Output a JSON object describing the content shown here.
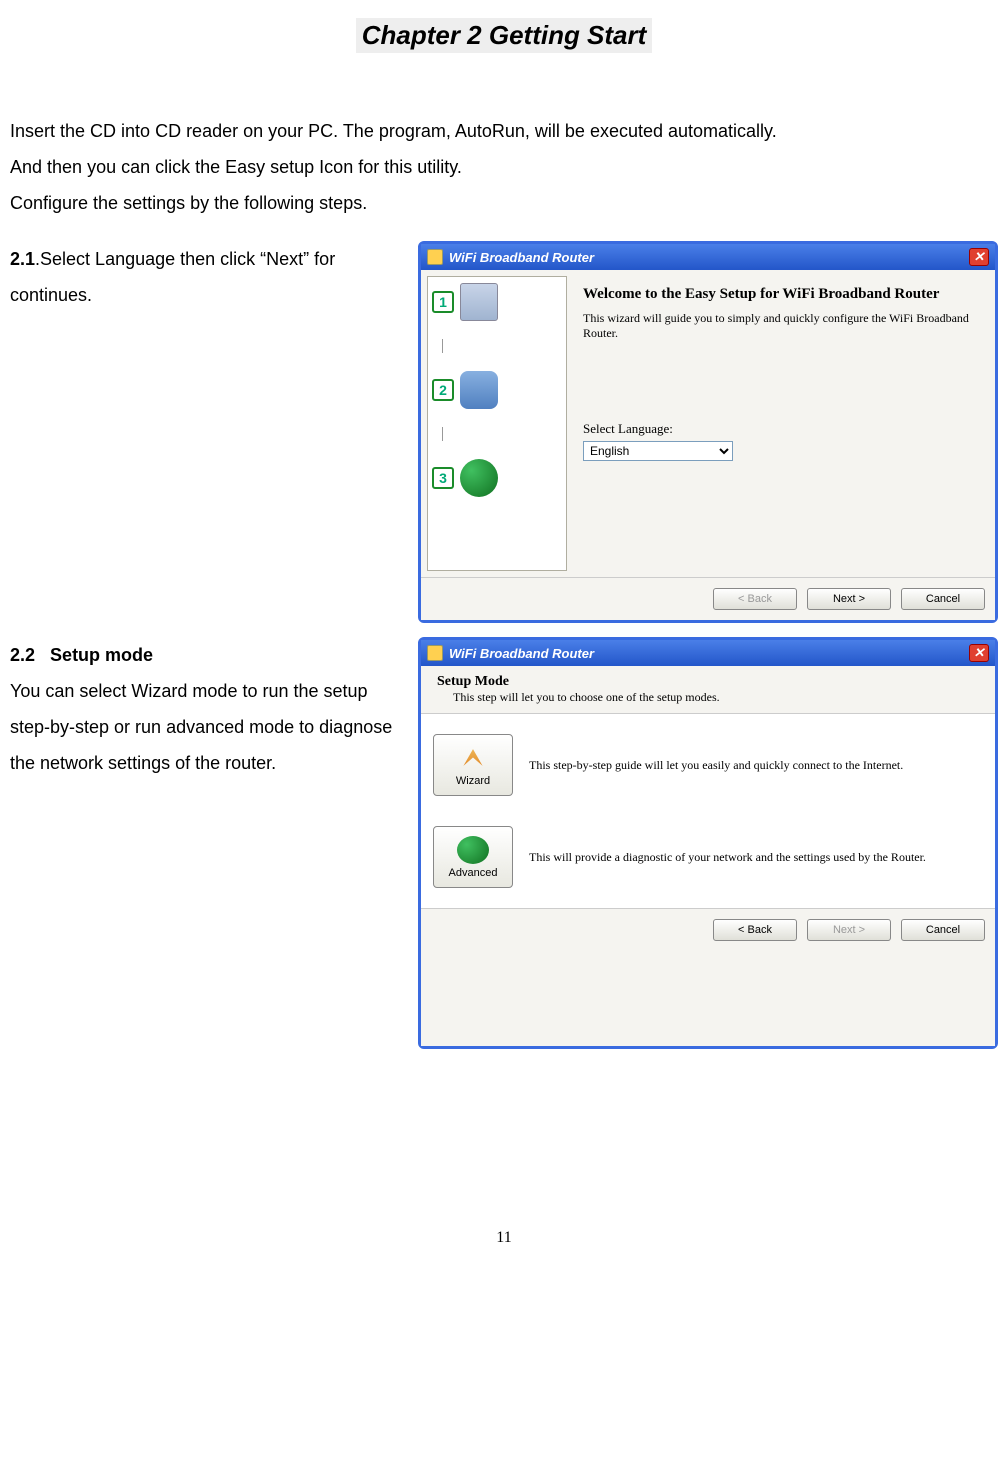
{
  "chapter_title": "Chapter 2    Getting Start",
  "intro_lines": [
    "Insert the CD into CD reader on your PC. The program, AutoRun, will be executed automatically.",
    "And then you can click the Easy setup Icon for this utility.",
    "Configure the settings by the following steps."
  ],
  "section21": {
    "num": "2.1",
    "text": ".Select Language then click “Next” for continues."
  },
  "section22": {
    "num": "2.2",
    "heading": "Setup mode",
    "text": "You can select Wizard mode to run the setup step-by-step or run advanced mode to diagnose the network settings of the router."
  },
  "dialog1": {
    "title": "WiFi Broadband Router",
    "welcome_title": "Welcome to the Easy Setup for WiFi Broadband Router",
    "welcome_sub": "This wizard will guide you to simply and quickly configure the WiFi Broadband Router.",
    "lang_label": "Select Language:",
    "lang_value": "English",
    "steps": [
      "1",
      "2",
      "3"
    ],
    "btn_back": "< Back",
    "btn_next": "Next >",
    "btn_cancel": "Cancel"
  },
  "dialog2": {
    "title": "WiFi Broadband Router",
    "head_title": "Setup Mode",
    "head_sub": "This step will let you to choose one of the setup modes.",
    "wizard_label": "Wizard",
    "wizard_desc": "This step-by-step guide will let you easily and quickly connect to the Internet.",
    "advanced_label": "Advanced",
    "advanced_desc": "This will provide a diagnostic of your network and the settings used by the Router.",
    "btn_back": "< Back",
    "btn_next": "Next >",
    "btn_cancel": "Cancel"
  },
  "page_number": "11"
}
